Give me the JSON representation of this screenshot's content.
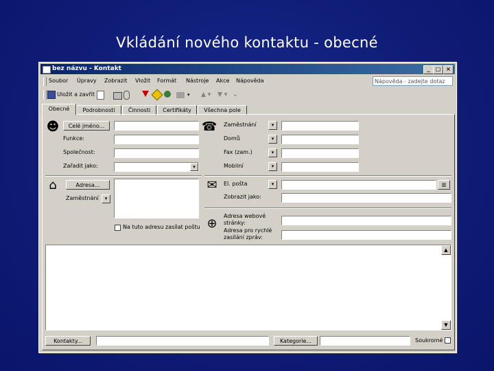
{
  "slide": {
    "title": "Vkládání nového kontaktu - obecné"
  },
  "window": {
    "title": "bez názvu - Kontakt",
    "controls": {
      "minimize": "_",
      "maximize": "□",
      "close": "×"
    }
  },
  "menu": {
    "items": [
      "Soubor",
      "Úpravy",
      "Zobrazit",
      "Vložit",
      "Formát",
      "Nástroje",
      "Akce",
      "Nápověda"
    ],
    "help_placeholder": "Nápověda - zadejte dotaz"
  },
  "toolbar": {
    "save_close": "Uložit a zavřít"
  },
  "tabs": [
    "Obecné",
    "Podrobnosti",
    "Činnosti",
    "Certifikáty",
    "Všechna pole"
  ],
  "general": {
    "full_name_button": "Celé jméno...",
    "job_title_label": "Funkce:",
    "company_label": "Společnost:",
    "file_as_label": "Zařadit jako:",
    "address_button": "Adresa...",
    "address_type": "Zaměstnání",
    "mailing_checkbox": "Na tuto adresu zasílat poštu",
    "phones": [
      "Zaměstnání",
      "Domů",
      "Fax (zam.)",
      "Mobilní"
    ],
    "email_label": "El. pošta",
    "display_as_label": "Zobrazit jako:",
    "web_label": "Adresa webové stránky:",
    "im_label": "Adresa pro rychlé zasílání zpráv:"
  },
  "bottom": {
    "contacts_button": "Kontakty...",
    "categories_button": "Kategorie...",
    "private_label": "Soukromé"
  }
}
